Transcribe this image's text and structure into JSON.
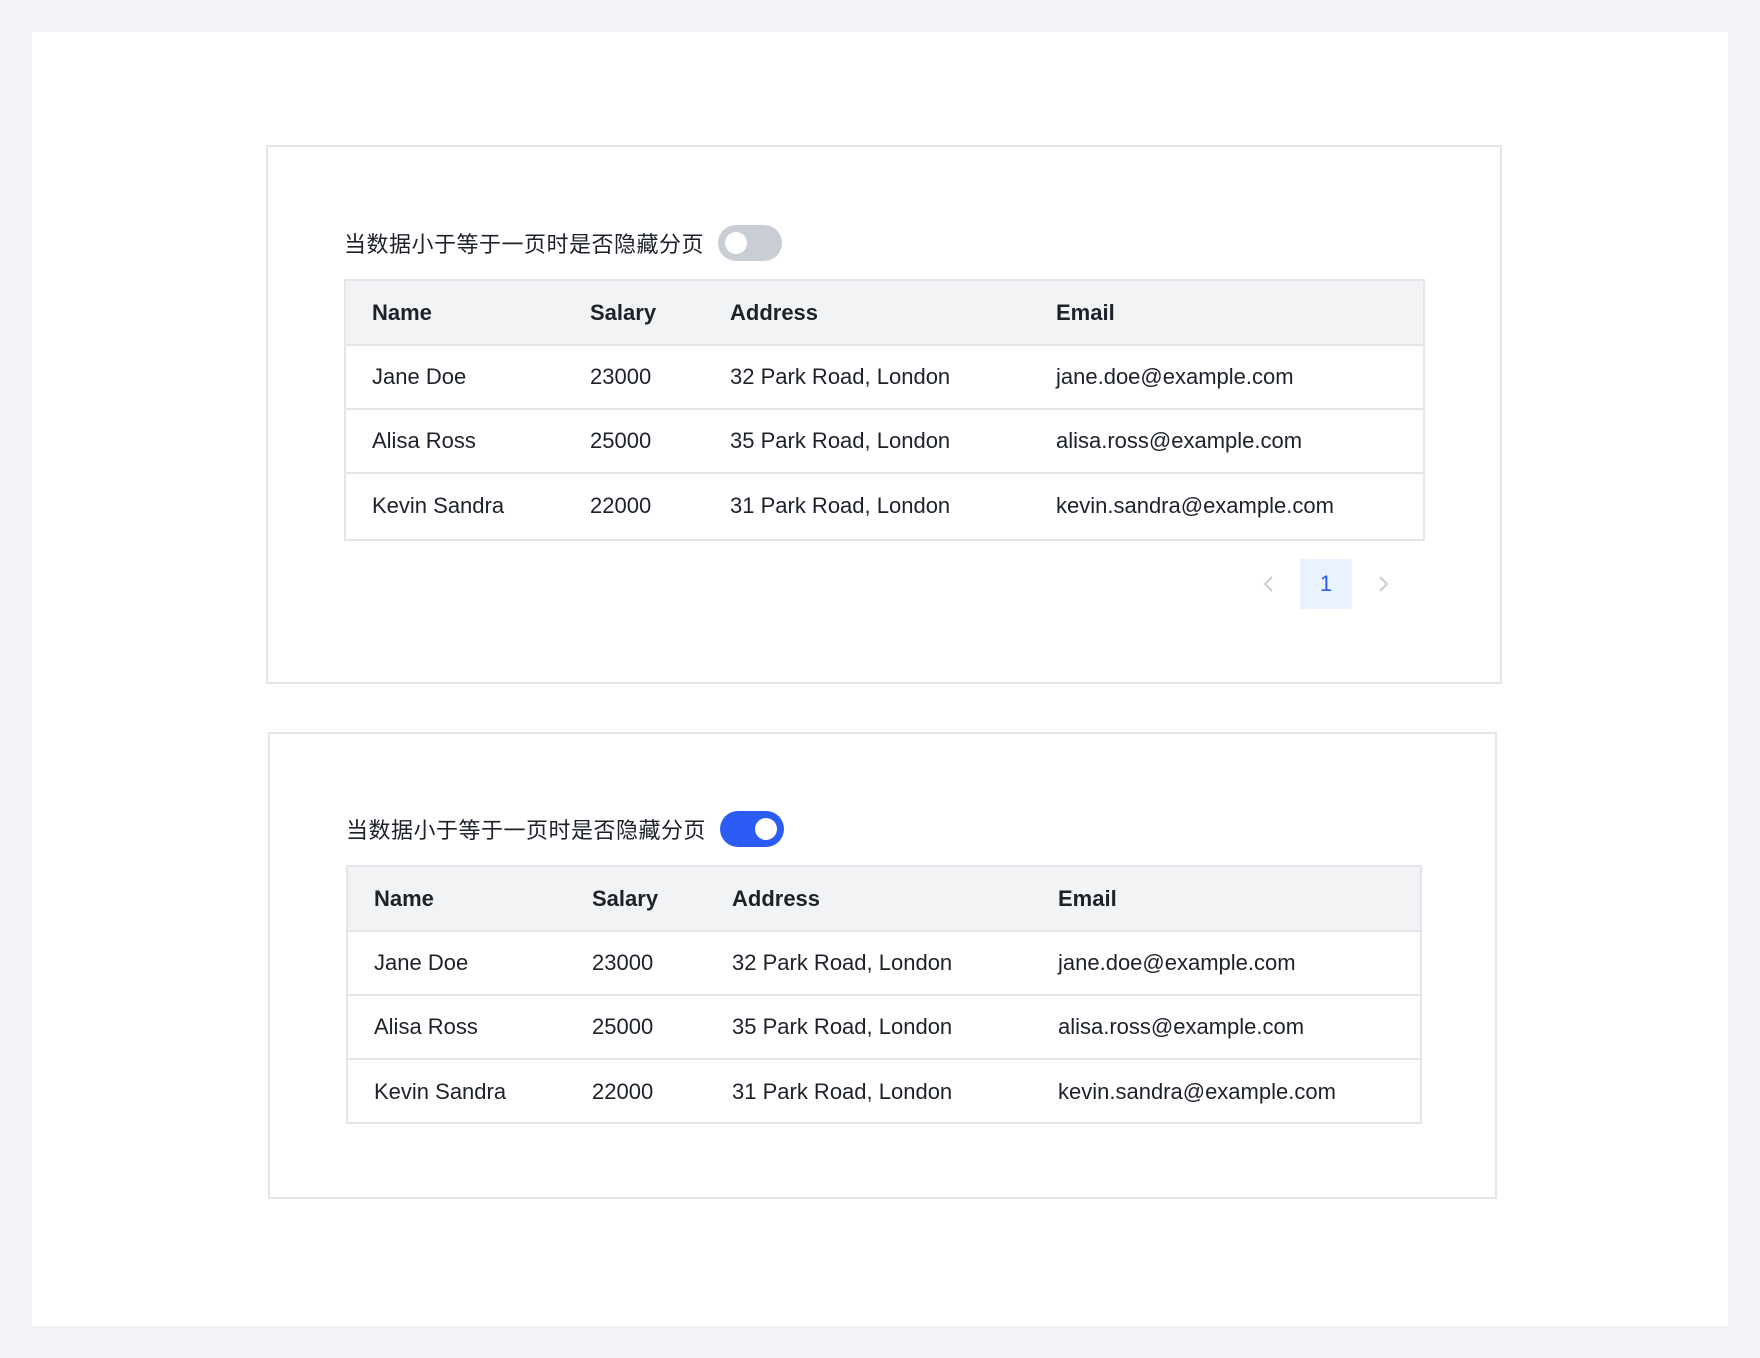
{
  "option_label": "当数据小于等于一页时是否隐藏分页",
  "colors": {
    "switch_on": "#2b5cf5",
    "switch_off": "#c9cdd4",
    "accent": "#2b5cf5"
  },
  "columns": [
    "Name",
    "Salary",
    "Address",
    "Email"
  ],
  "rows": [
    {
      "name": "Jane Doe",
      "salary": "23000",
      "address": "32 Park Road, London",
      "email": "jane.doe@example.com"
    },
    {
      "name": "Alisa Ross",
      "salary": "25000",
      "address": "35 Park Road, London",
      "email": "alisa.ross@example.com"
    },
    {
      "name": "Kevin Sandra",
      "salary": "22000",
      "address": "31 Park Road, London",
      "email": "kevin.sandra@example.com"
    }
  ],
  "demo1": {
    "hide_on_single_page": false
  },
  "demo2": {
    "hide_on_single_page": true
  },
  "pagination": {
    "current_page": "1",
    "prev_icon": "chevron-left-icon",
    "next_icon": "chevron-right-icon"
  }
}
